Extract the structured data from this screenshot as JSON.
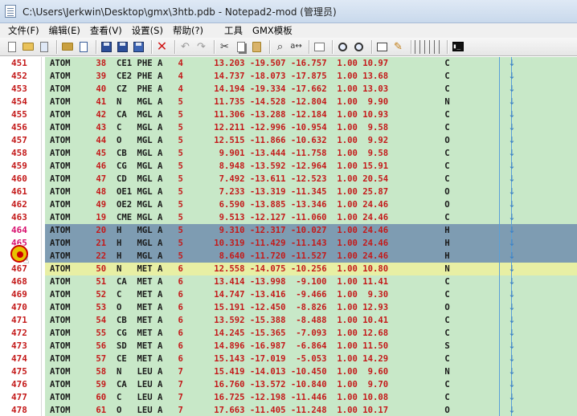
{
  "window": {
    "title": "C:\\Users\\Jerkwin\\Desktop\\gmx\\3htb.pdb - Notepad2-mod (管理员)"
  },
  "menu": {
    "items": [
      "文件(F)",
      "编辑(E)",
      "查看(V)",
      "设置(S)",
      "帮助(?)",
      "工具",
      "GMX模板"
    ]
  },
  "toolbar": {
    "icons": [
      "new-file-icon",
      "open-folder-icon",
      "reopen-icon",
      "browse-icon",
      "open-with-icon",
      "save-icon",
      "save-as-icon",
      "save-copy-icon",
      "close-icon",
      "undo-icon",
      "redo-icon",
      "cut-icon",
      "copy-icon",
      "paste-icon",
      "find-icon",
      "replace-icon",
      "word-wrap-icon",
      "zoom-in-icon",
      "zoom-out-icon",
      "scheme-icon",
      "edit-scheme-icon",
      "terminal-icon"
    ]
  },
  "colors": {
    "text_area_bg": "#c8e8c8",
    "selection_bg": "#7e9cb2",
    "current_line_bg": "#e8efa4",
    "line_number": "#c41a1a",
    "selected_line_number": "#d8106e"
  },
  "lines": [
    {
      "n": "451",
      "text": "ATOM     38  CE1 PHE A   4      13.203 -19.507 -16.757  1.00 10.97           C"
    },
    {
      "n": "452",
      "text": "ATOM     39  CE2 PHE A   4      14.737 -18.073 -17.875  1.00 13.68           C"
    },
    {
      "n": "453",
      "text": "ATOM     40  CZ  PHE A   4      14.194 -19.334 -17.662  1.00 13.03           C"
    },
    {
      "n": "454",
      "text": "ATOM     41  N   MGL A   5      11.735 -14.528 -12.804  1.00  9.90           N"
    },
    {
      "n": "455",
      "text": "ATOM     42  CA  MGL A   5      11.306 -13.288 -12.184  1.00 10.93           C"
    },
    {
      "n": "456",
      "text": "ATOM     43  C   MGL A   5      12.211 -12.996 -10.954  1.00  9.58           C"
    },
    {
      "n": "457",
      "text": "ATOM     44  O   MGL A   5      12.515 -11.866 -10.632  1.00  9.92           O"
    },
    {
      "n": "458",
      "text": "ATOM     45  CB  MGL A   5       9.901 -13.444 -11.758  1.00  9.58           C"
    },
    {
      "n": "459",
      "text": "ATOM     46  CG  MGL A   5       8.948 -13.592 -12.964  1.00 15.91           C"
    },
    {
      "n": "460",
      "text": "ATOM     47  CD  MGL A   5       7.492 -13.611 -12.523  1.00 20.54           C"
    },
    {
      "n": "461",
      "text": "ATOM     48  OE1 MGL A   5       7.233 -13.319 -11.345  1.00 25.87           O"
    },
    {
      "n": "462",
      "text": "ATOM     49  OE2 MGL A   5       6.590 -13.885 -13.346  1.00 24.46           O"
    },
    {
      "n": "463",
      "text": "ATOM     19  CME MGL A   5       9.513 -12.127 -11.060  1.00 24.46           C"
    },
    {
      "n": "464",
      "text": "ATOM     20  H   MGL A   5       9.310 -12.317 -10.027  1.00 24.46           H"
    },
    {
      "n": "465",
      "text": "ATOM     21  H   MGL A   5      10.319 -11.429 -11.143  1.00 24.46           H"
    },
    {
      "n": "466",
      "text": "ATOM     22  H   MGL A   5       8.640 -11.720 -11.527  1.00 24.46           H"
    },
    {
      "n": "467",
      "text": "ATOM     50  N   MET A   6      12.558 -14.075 -10.256  1.00 10.80           N"
    },
    {
      "n": "468",
      "text": "ATOM     51  CA  MET A   6      13.414 -13.998  -9.100  1.00 11.41           C"
    },
    {
      "n": "469",
      "text": "ATOM     52  C   MET A   6      14.747 -13.416  -9.466  1.00  9.30           C"
    },
    {
      "n": "470",
      "text": "ATOM     53  O   MET A   6      15.191 -12.450  -8.826  1.00 12.93           O"
    },
    {
      "n": "471",
      "text": "ATOM     54  CB  MET A   6      13.592 -15.388  -8.488  1.00 10.41           C"
    },
    {
      "n": "472",
      "text": "ATOM     55  CG  MET A   6      14.245 -15.365  -7.093  1.00 12.68           C"
    },
    {
      "n": "473",
      "text": "ATOM     56  SD  MET A   6      14.896 -16.987  -6.864  1.00 11.50           S"
    },
    {
      "n": "474",
      "text": "ATOM     57  CE  MET A   6      15.143 -17.019  -5.053  1.00 14.29           C"
    },
    {
      "n": "475",
      "text": "ATOM     58  N   LEU A   7      15.419 -14.013 -10.450  1.00  9.60           N"
    },
    {
      "n": "476",
      "text": "ATOM     59  CA  LEU A   7      16.760 -13.572 -10.840  1.00  9.70           C"
    },
    {
      "n": "477",
      "text": "ATOM     60  C   LEU A   7      16.725 -12.198 -11.446  1.00 10.08           C"
    },
    {
      "n": "478",
      "text": "ATOM     61  O   LEU A   7      17.663 -11.405 -11.248  1.00 10.17           O"
    }
  ],
  "selected_lines": [
    "464",
    "465",
    "466"
  ],
  "current_line": "467",
  "column_markers": [
    "|",
    "|"
  ]
}
